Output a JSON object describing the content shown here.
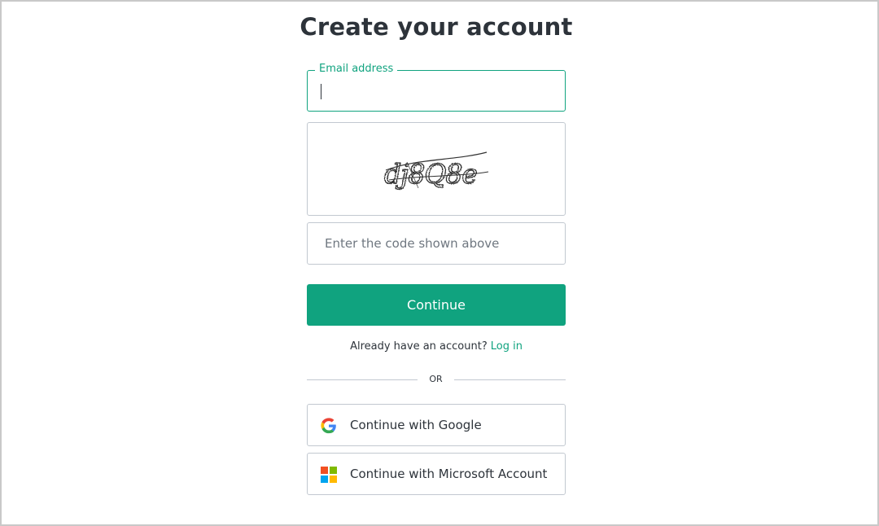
{
  "page": {
    "title": "Create your account"
  },
  "email": {
    "label": "Email address",
    "value": ""
  },
  "captcha": {
    "code": "dj8Q8e",
    "icon": "captcha-image"
  },
  "code_input": {
    "placeholder": "Enter the code shown above",
    "value": ""
  },
  "continue_button": {
    "label": "Continue"
  },
  "login": {
    "prompt": "Already have an account?",
    "link": "Log in"
  },
  "divider": {
    "text": "OR"
  },
  "social": {
    "google_label": "Continue with Google",
    "microsoft_label": "Continue with Microsoft Account"
  },
  "colors": {
    "accent": "#10a37f",
    "border": "#c2c8d0",
    "text": "#2d333a"
  }
}
